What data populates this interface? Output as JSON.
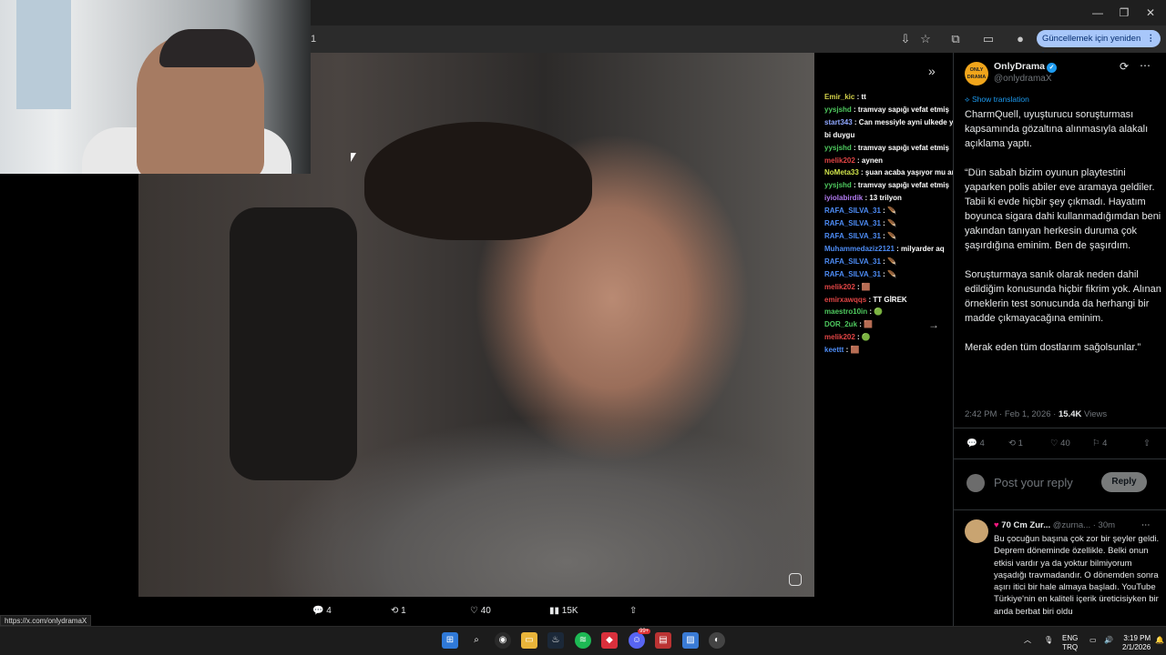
{
  "browser": {
    "omnibox_tail": "1",
    "update_label": "Güncellemek için yeniden başlat",
    "minimize": "—",
    "maximize": "❐",
    "close": "✕",
    "status_url": "https://x.com/onlydramaX"
  },
  "chat": {
    "messages": [
      {
        "user": "Emir_kic",
        "color": "#d4d24a",
        "msg": " : tt"
      },
      {
        "user": "yysjshd",
        "color": "#4ec95e",
        "msg": " : tramvay sapığı vefat etmiş"
      },
      {
        "user": "start343",
        "color": "#8fa7ff",
        "msg": " : Can messiyle ayni ulkede yasamak nasil"
      },
      {
        "user": "",
        "color": "#fff",
        "msg": "bi duygu"
      },
      {
        "user": "yysjshd",
        "color": "#4ec95e",
        "msg": " : tramvay sapığı vefat etmiş"
      },
      {
        "user": "melik202",
        "color": "#e04444",
        "msg": " : aynen"
      },
      {
        "user": "NoMeta33",
        "color": "#cfe24a",
        "msg": " : şuan acaba yaşıyor mu ami"
      },
      {
        "user": "yysjshd",
        "color": "#4ec95e",
        "msg": " : tramvay sapığı vefat etmiş"
      },
      {
        "user": "iyiolabirdik",
        "color": "#b37bf2",
        "msg": " : 13 trilyon"
      },
      {
        "user": "RAFA_SILVA_31",
        "color": "#4d8cf5",
        "msg": " : 🪶"
      },
      {
        "user": "RAFA_SILVA_31",
        "color": "#4d8cf5",
        "msg": " : 🪶"
      },
      {
        "user": "RAFA_SILVA_31",
        "color": "#4d8cf5",
        "msg": " : 🪶"
      },
      {
        "user": "Muhammedaziz2121",
        "color": "#4d8cf5",
        "msg": " : milyarder aq"
      },
      {
        "user": "RAFA_SILVA_31",
        "color": "#4d8cf5",
        "msg": " : 🪶"
      },
      {
        "user": "RAFA_SILVA_31",
        "color": "#4d8cf5",
        "msg": " : 🪶"
      },
      {
        "user": "melik202",
        "color": "#e04444",
        "msg": " : 🟫"
      },
      {
        "user": "emirxawqqs",
        "color": "#e04444",
        "msg": " : TT GİREK"
      },
      {
        "user": "maestro10in",
        "color": "#4ec95e",
        "msg": " : 🟢"
      },
      {
        "user": "DOR_2uk",
        "color": "#4ec95e",
        "msg": " : 🟫"
      },
      {
        "user": "melik202",
        "color": "#e04444",
        "msg": " : 🟢"
      },
      {
        "user": "keettt",
        "color": "#4d8cf5",
        "msg": " : 🟫"
      }
    ]
  },
  "media_actions": {
    "replies": "4",
    "reposts": "1",
    "likes": "40",
    "views": "15K"
  },
  "tweet": {
    "author_name": "OnlyDrama",
    "author_handle": "@onlydramaX",
    "avatar_text": "ONLY DRAMA",
    "show_translation": "Show translation",
    "paragraphs": [
      "CharmQuell, uyuşturucu soruşturması kapsamında gözaltına alınmasıyla alakalı açıklama yaptı.",
      "“Dün sabah bizim oyunun playtestini yaparken polis abiler eve aramaya geldiler. Tabii ki evde hiçbir şey çıkmadı. Hayatım boyunca sigara dahi kullanmadığımdan beni yakından tanıyan herkesin duruma çok şaşırdığına eminim. Ben de şaşırdım.",
      "Soruşturmaya sanık olarak neden dahil edildiğim konusunda hiçbir fikrim yok. Alınan örneklerin test sonucunda da herhangi bir madde çıkmayacağına eminim.",
      "Merak eden tüm dostlarım sağolsunlar.”"
    ],
    "time": "2:42 PM · Feb 1, 2026 · ",
    "views_count": "15.4K",
    "views_label": " Views",
    "replies": "4",
    "reposts": "1",
    "likes": "40",
    "bookmarks": "4",
    "reply_placeholder": "Post your reply",
    "reply_button": "Reply"
  },
  "reply": {
    "name": "70 Cm Zur...",
    "handle": "@zurna...",
    "time": "· 30m",
    "text": "Bu çocuğun başına çok zor bir şeyler geldi. Deprem döneminde özellikle. Belki onun etkisi vardır ya da yoktur bilmiyorum yaşadığı travmadandır. O dönemden sonra aşırı itici bir hale almaya başladı. YouTube Türkiye'nin en kaliteli içerik üreticisiyken bir anda berbat biri oldu"
  },
  "taskbar": {
    "lang1": "ENG",
    "lang2": "TRQ",
    "time": "3:19 PM",
    "date": "2/1/2026",
    "badge": "99+"
  }
}
